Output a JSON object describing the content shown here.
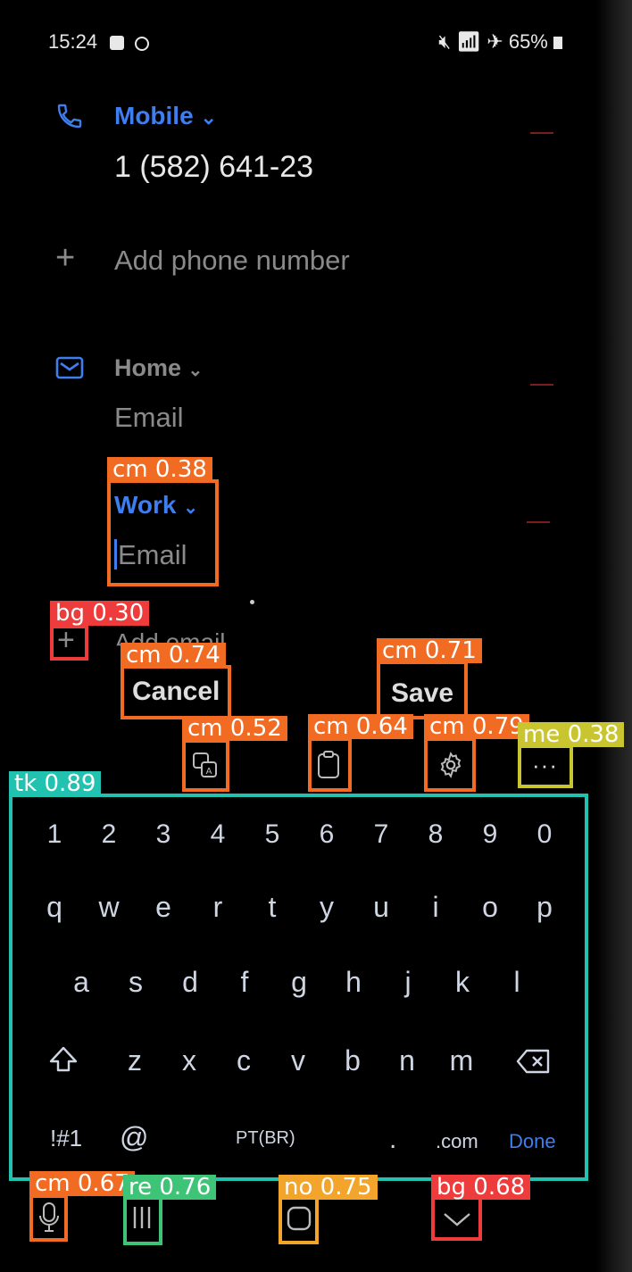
{
  "status_bar": {
    "time": "15:24",
    "battery": "65%"
  },
  "phone": {
    "label": "Mobile",
    "number": "1 (582) 641-23",
    "add_label": "Add phone number"
  },
  "email_home": {
    "label": "Home",
    "placeholder": "Email"
  },
  "email_work": {
    "label": "Work",
    "placeholder": "Email"
  },
  "add_email": "Add email",
  "actions": {
    "cancel": "Cancel",
    "save": "Save"
  },
  "keyboard": {
    "row_numbers": [
      "1",
      "2",
      "3",
      "4",
      "5",
      "6",
      "7",
      "8",
      "9",
      "0"
    ],
    "row1": [
      "q",
      "w",
      "e",
      "r",
      "t",
      "y",
      "u",
      "i",
      "o",
      "p"
    ],
    "row2": [
      "a",
      "s",
      "d",
      "f",
      "g",
      "h",
      "j",
      "k",
      "l"
    ],
    "row3": [
      "z",
      "x",
      "c",
      "v",
      "b",
      "n",
      "m"
    ],
    "symbols": "!#1",
    "at": "@",
    "language": "PT(BR)",
    "period": ".",
    "dotcom": ".com",
    "done": "Done"
  },
  "detections": {
    "work_field": "cm 0.38",
    "add_button": "bg 0.30",
    "cancel": "cm 0.74",
    "save": "cm 0.71",
    "translate": "cm 0.52",
    "clipboard": "cm 0.64",
    "settings": "cm 0.79",
    "more": "me 0.38",
    "keyboard": "tk 0.89",
    "mic": "cm 0.67",
    "recents": "re 0.76",
    "home": "no 0.75",
    "back": "bg 0.68"
  },
  "colors": {
    "accent": "#3f7ef0",
    "done": "#3f7ef0"
  }
}
